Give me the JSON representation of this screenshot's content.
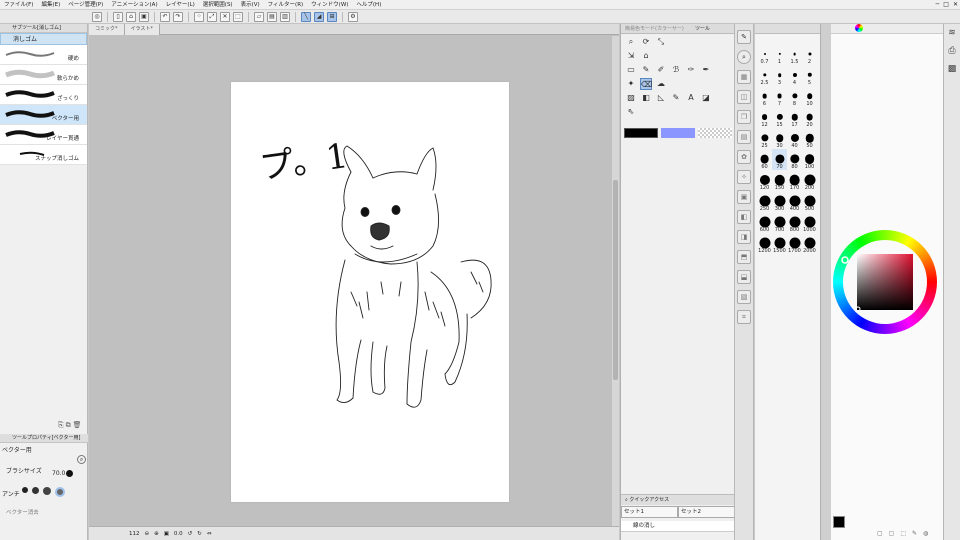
{
  "menu": [
    "ファイル(F)",
    "編集(E)",
    "ページ管理(P)",
    "アニメーション(A)",
    "レイヤー(L)",
    "選択範囲(S)",
    "表示(V)",
    "フィルター(R)",
    "ウィンドウ(W)",
    "ヘルプ(H)"
  ],
  "window_controls": {
    "minimize": "─",
    "maximize": "□",
    "close": "✕"
  },
  "left_panel": {
    "tab_label": "サブツール[消しゴム]",
    "title": "消しゴム",
    "brushes": [
      {
        "label": "硬め"
      },
      {
        "label": "軟らかめ"
      },
      {
        "label": "ざっくり"
      },
      {
        "label": "ベクター用"
      },
      {
        "label": "レイヤー貫通"
      },
      {
        "label": "スナップ消しゴム"
      }
    ],
    "tool_property_tab": "ツールプロパティ[ベクター用]",
    "tool_property_name": "ベクター用",
    "brush_size_label": "ブラシサイズ",
    "brush_size_value": "70.0",
    "antialias_label": "アンチ",
    "vector_erase_label": "ベクター消去"
  },
  "document_tabs": [
    "コミック*",
    "イラスト*"
  ],
  "canvas_text": "プ。1",
  "status": {
    "zoom": "112",
    "angle": "0.0"
  },
  "tool_panel": {
    "header_left": "簡易色モード(カラーサー)",
    "header_right": "ツール",
    "quick_access_label": "クイックアクセス",
    "sets": [
      "セット1",
      "セット2"
    ],
    "bottom_item": "線の消し"
  },
  "brush_sizes": [
    "0.7",
    "1",
    "1.5",
    "2",
    "2.5",
    "3",
    "4",
    "5",
    "6",
    "7",
    "8",
    "10",
    "12",
    "15",
    "17",
    "20",
    "25",
    "30",
    "40",
    "50",
    "60",
    "70",
    "80",
    "100",
    "120",
    "150",
    "170",
    "200",
    "250",
    "300",
    "400",
    "500",
    "600",
    "700",
    "800",
    "1000",
    "1200",
    "1500",
    "1700",
    "2000"
  ],
  "selected_brush_size": "70",
  "colors": {
    "main": "#000000",
    "sub": "#8080ff",
    "accent": "#5a86c0",
    "swatch_blue": "#8c96ff"
  }
}
